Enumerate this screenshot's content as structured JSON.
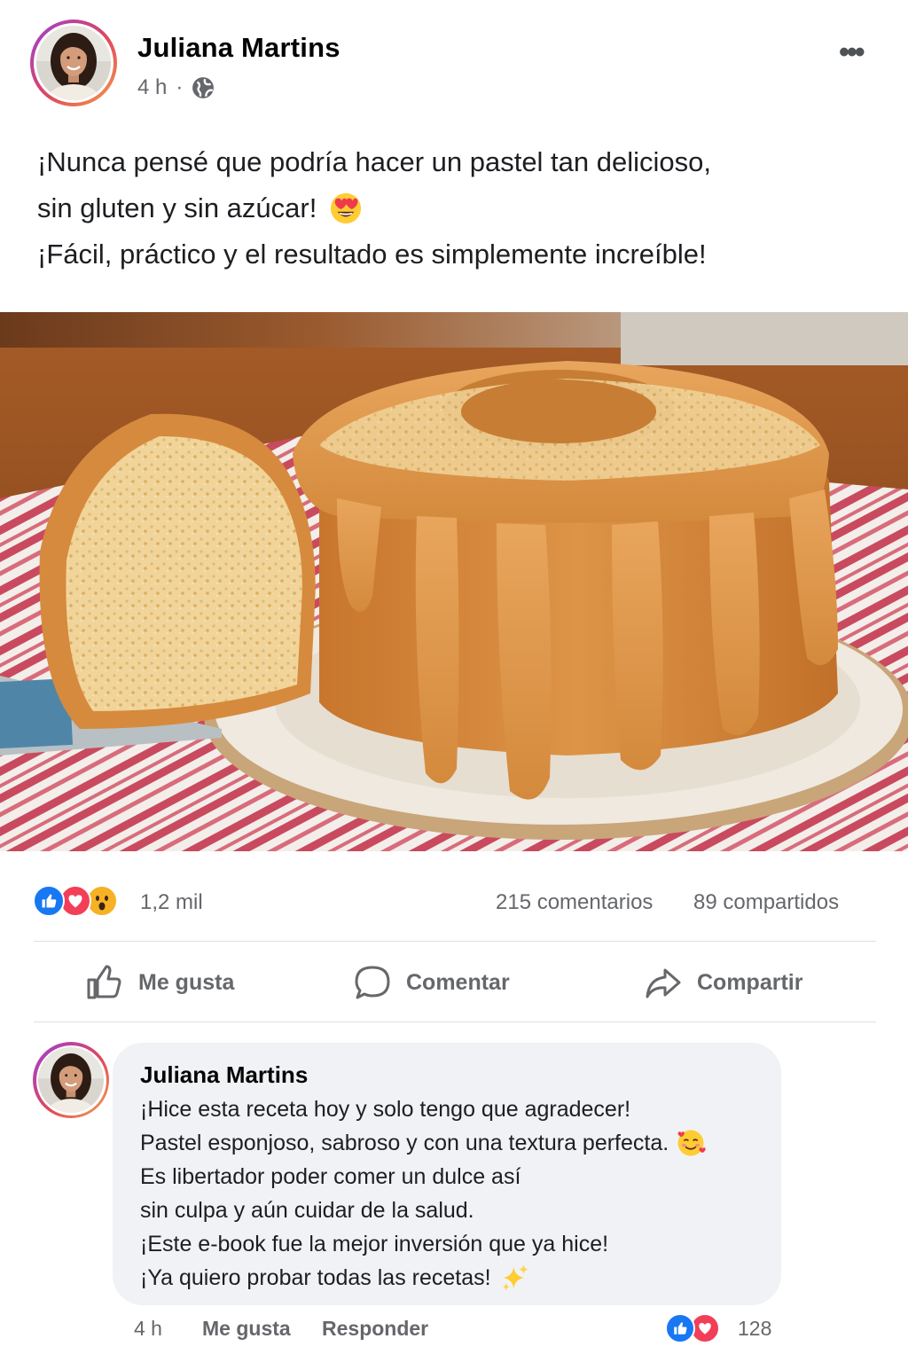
{
  "post": {
    "author": "Juliana Martins",
    "time": "4 h",
    "separator": "·",
    "more_label": "•••",
    "text_lines": [
      "¡Nunca pensé que podría hacer un pastel tan delicioso,",
      "sin gluten y sin azúcar!",
      "¡Fácil, práctico y el resultado es simplemente increíble!"
    ],
    "emoji": "heart-eyes-emoji",
    "image_description": "bundt-cake-with-caramel-glaze"
  },
  "stats": {
    "reactions_count": "1,2 mil",
    "reaction_types": [
      "like",
      "love",
      "wow"
    ],
    "comments": "215 comentarios",
    "shares": "89 compartidos"
  },
  "actions": {
    "like": "Me gusta",
    "comment": "Comentar",
    "share": "Compartir"
  },
  "comment": {
    "author": "Juliana Martins",
    "lines": [
      "¡Hice esta receta hoy y solo tengo que agradecer!",
      "Pastel esponjoso, sabroso y con una textura perfecta.",
      "Es libertador poder comer un dulce así",
      "sin culpa y aún cuidar de la salud.",
      "¡Este e-book fue la mejor inversión que ya hice!",
      "¡Ya quiero probar todas las recetas!"
    ],
    "time": "4 h",
    "like_label": "Me gusta",
    "reply_label": "Responder",
    "reactions_count": "128"
  },
  "colors": {
    "like_blue": "#1877f2",
    "love_red": "#f33e58",
    "wow_yellow": "#f7b125",
    "text_secondary": "#65676b"
  }
}
